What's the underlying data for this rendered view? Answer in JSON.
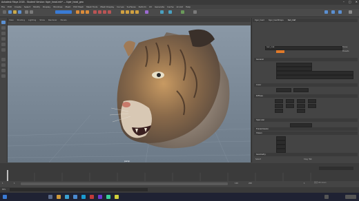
{
  "titlebar": {
    "title": "Autodesk Maya 2018 - Student Version: tiger_head.mb* --- tiger_head_geo",
    "minimize": "–",
    "maximize": "□",
    "close": "✕"
  },
  "menubar": {
    "items": [
      "File",
      "Edit",
      "Create",
      "Select",
      "Modify",
      "Display",
      "Windows",
      "Mesh",
      "Edit Mesh",
      "Mesh Tools",
      "Mesh Display",
      "Curves",
      "Surfaces",
      "Deform",
      "UV",
      "Generate",
      "Cache",
      "Arnold",
      "Help"
    ]
  },
  "viewport": {
    "menus": [
      "View",
      "Shading",
      "Lighting",
      "Show",
      "Renderer",
      "Panels"
    ],
    "camera_label": "persp"
  },
  "attribute_editor": {
    "tabs": [
      "tiger_head",
      "tiger_headShape",
      "hair_mat"
    ],
    "sections": [
      "General",
      "Color",
      "Diffuse",
      "Specular",
      "Transmission",
      "Sheen",
      "Geometry"
    ],
    "name_value": "hair_mat",
    "focus_button": "Focus",
    "presets_button": "Presets",
    "select_button": "Select",
    "copy_tab_button": "Copy Tab"
  },
  "timeline": {
    "start": "1",
    "end": "120",
    "current": "1",
    "range_start": "1",
    "range_end": "200"
  },
  "statusbar": {
    "mel_label": "MEL",
    "activation_text": "激活 Windows"
  },
  "colors": {
    "accent": "#3a7bd5",
    "swatch": "#e07a2a"
  }
}
